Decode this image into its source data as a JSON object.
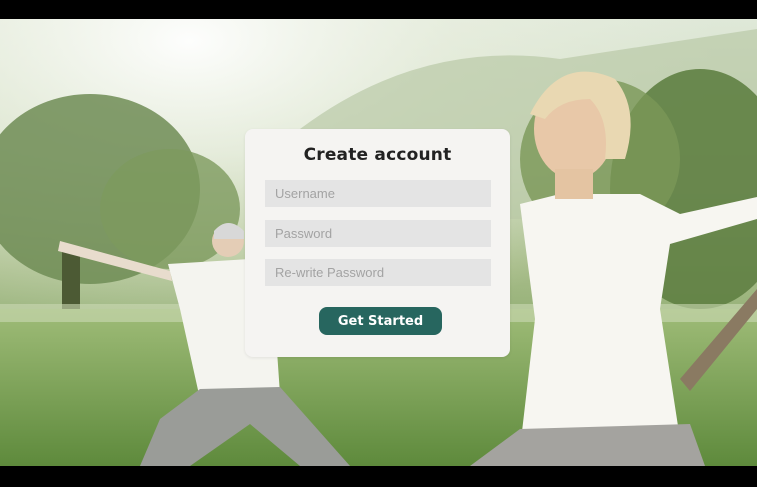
{
  "signup": {
    "title": "Create account",
    "username_placeholder": "Username",
    "password_placeholder": "Password",
    "rewrite_password_placeholder": "Re-write Password",
    "submit_label": "Get Started"
  },
  "colors": {
    "accent": "#27665f",
    "card_background": "#f5f4f2",
    "field_background": "#e4e4e4"
  }
}
